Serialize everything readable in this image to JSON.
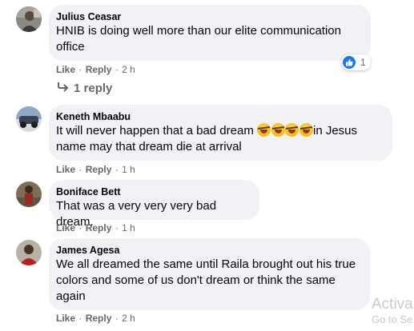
{
  "comments": [
    {
      "author": "Julius Ceasar",
      "text_lines": [
        "HNIB is doing well more than our elite communication",
        "office"
      ],
      "like": "Like",
      "reply": "Reply",
      "time": "2 h",
      "reaction_count": "1",
      "replies_label": "1 reply"
    },
    {
      "author": "Keneth Mbaabu",
      "text_line1_before": "It will never happen that a bad dream ",
      "text_line1_after": "in Jesus",
      "emoji_name": "rolling-on-floor-laughing-emoji",
      "text_line2": "name may that dream die at arrival",
      "like": "Like",
      "reply": "Reply",
      "time": "1 h"
    },
    {
      "author": "Boniface Bett",
      "text_lines": [
        "That was a very very very bad dream."
      ],
      "like": "Like",
      "reply": "Reply",
      "time": "1 h"
    },
    {
      "author": "James Agesa",
      "text_lines": [
        "We all dreamed the same until Raila brought out his true",
        "colors and some of us don't dream or think the same",
        "again"
      ],
      "like": "Like",
      "reply": "Reply",
      "time": "2 h"
    }
  ],
  "watermark": {
    "line1": "Activa",
    "line2": "Go to Se"
  },
  "colors": {
    "bubble": "#f0f2f5",
    "meta": "#65676b",
    "like_blue": "#1877f2"
  }
}
